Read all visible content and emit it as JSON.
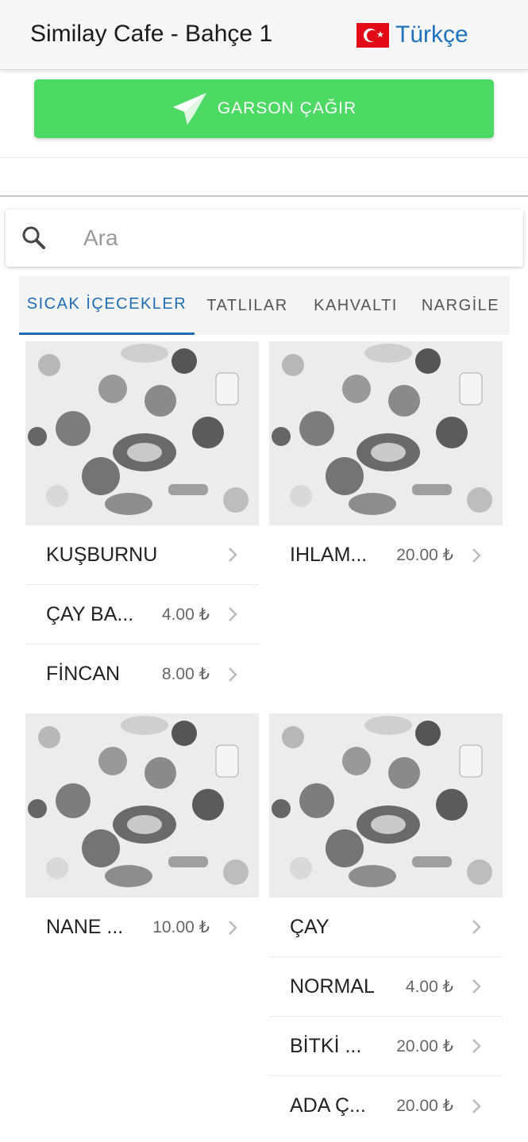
{
  "header": {
    "title": "Similay Cafe - Bahçe 1",
    "language": "Türkçe",
    "flag_icon": "turkey-flag-icon"
  },
  "waiter_button": {
    "label": "GARSON ÇAĞIR",
    "icon": "send-icon",
    "color": "#4cd964"
  },
  "search": {
    "placeholder": "Ara",
    "value": "",
    "icon": "search-icon"
  },
  "tabs": [
    {
      "label": "SICAK İÇECEKLER",
      "active": true
    },
    {
      "label": "TATLILAR",
      "active": false
    },
    {
      "label": "KAHVALTI",
      "active": false
    },
    {
      "label": "NARGİLE",
      "active": false
    }
  ],
  "accent_color": "#1e6db5",
  "cards": [
    {
      "image": "food-illustration-image",
      "items": [
        {
          "name": "KUŞBURNU",
          "price": ""
        },
        {
          "name": "ÇAY BA...",
          "price": "4.00 ₺"
        },
        {
          "name": "FİNCAN",
          "price": "8.00 ₺"
        }
      ]
    },
    {
      "image": "food-illustration-image",
      "items": [
        {
          "name": "IHLAM...",
          "price": "20.00 ₺"
        }
      ]
    },
    {
      "image": "food-illustration-image",
      "items": [
        {
          "name": "NANE ...",
          "price": "10.00 ₺"
        }
      ]
    },
    {
      "image": "food-illustration-image",
      "items": [
        {
          "name": "ÇAY",
          "price": ""
        },
        {
          "name": "NORMAL",
          "price": "4.00 ₺"
        },
        {
          "name": "BİTKİ ...",
          "price": "20.00 ₺"
        },
        {
          "name": "ADA Ç...",
          "price": "20.00 ₺"
        }
      ]
    }
  ]
}
